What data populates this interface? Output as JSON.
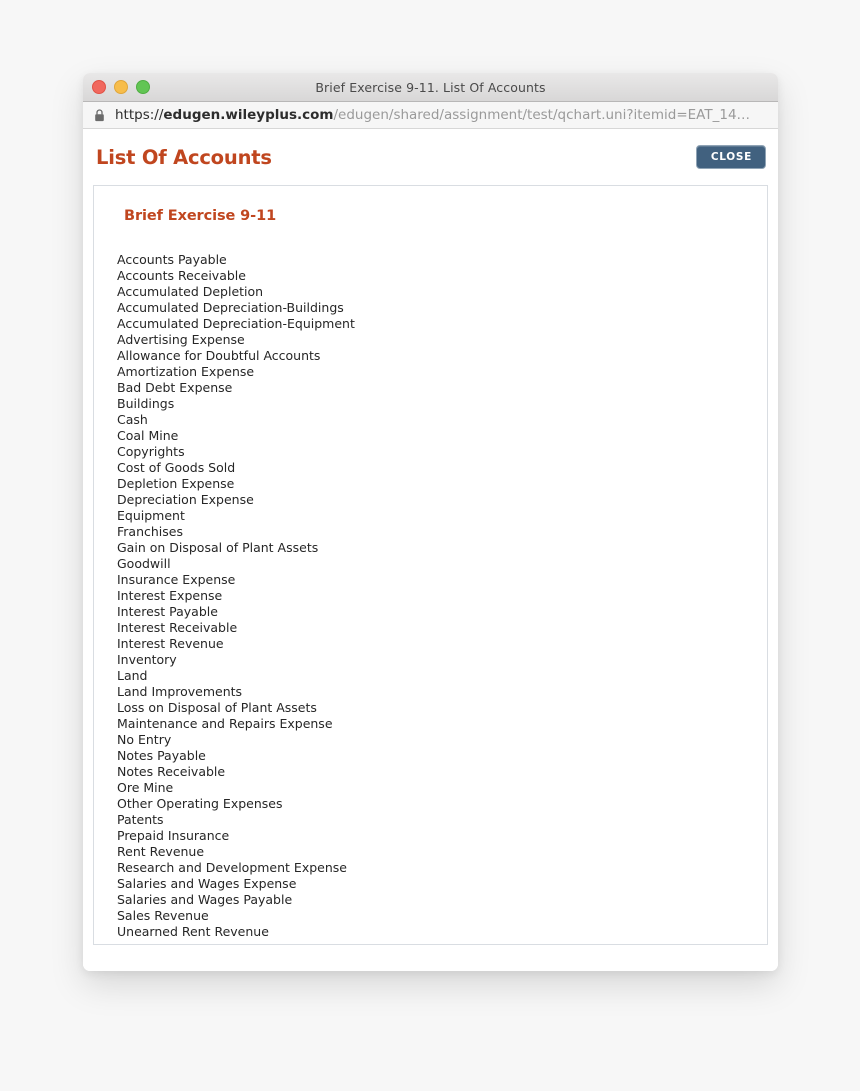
{
  "window": {
    "title": "Brief Exercise 9-11. List Of Accounts",
    "traffic_lights": [
      "close",
      "minimize",
      "zoom"
    ],
    "colors": {
      "red": "#f1685e",
      "yellow": "#f7bd4b",
      "green": "#62c554"
    }
  },
  "urlbar": {
    "scheme": "https://",
    "host": "edugen.wileyplus.com",
    "path": "/edugen/shared/assignment/test/qchart.uni?itemid=EAT_14…",
    "lock_icon": "lock-icon"
  },
  "page": {
    "title": "List Of Accounts",
    "close_label": "CLOSE",
    "accent_color": "#c0461f",
    "close_button_color": "#41617f"
  },
  "content": {
    "exercise_title": "Brief Exercise 9-11",
    "accounts": [
      "Accounts Payable",
      "Accounts Receivable",
      "Accumulated Depletion",
      "Accumulated Depreciation-Buildings",
      "Accumulated Depreciation-Equipment",
      "Advertising Expense",
      "Allowance for Doubtful Accounts",
      "Amortization Expense",
      "Bad Debt Expense",
      "Buildings",
      "Cash",
      "Coal Mine",
      "Copyrights",
      "Cost of Goods Sold",
      "Depletion Expense",
      "Depreciation Expense",
      "Equipment",
      "Franchises",
      "Gain on Disposal of Plant Assets",
      "Goodwill",
      "Insurance Expense",
      "Interest Expense",
      "Interest Payable",
      "Interest Receivable",
      "Interest Revenue",
      "Inventory",
      "Land",
      "Land Improvements",
      "Loss on Disposal of Plant Assets",
      "Maintenance and Repairs Expense",
      "No Entry",
      "Notes Payable",
      "Notes Receivable",
      "Ore Mine",
      "Other Operating Expenses",
      "Patents",
      "Prepaid Insurance",
      "Rent Revenue",
      "Research and Development Expense",
      "Salaries and Wages Expense",
      "Salaries and Wages Payable",
      "Sales Revenue",
      "Unearned Rent Revenue"
    ]
  }
}
